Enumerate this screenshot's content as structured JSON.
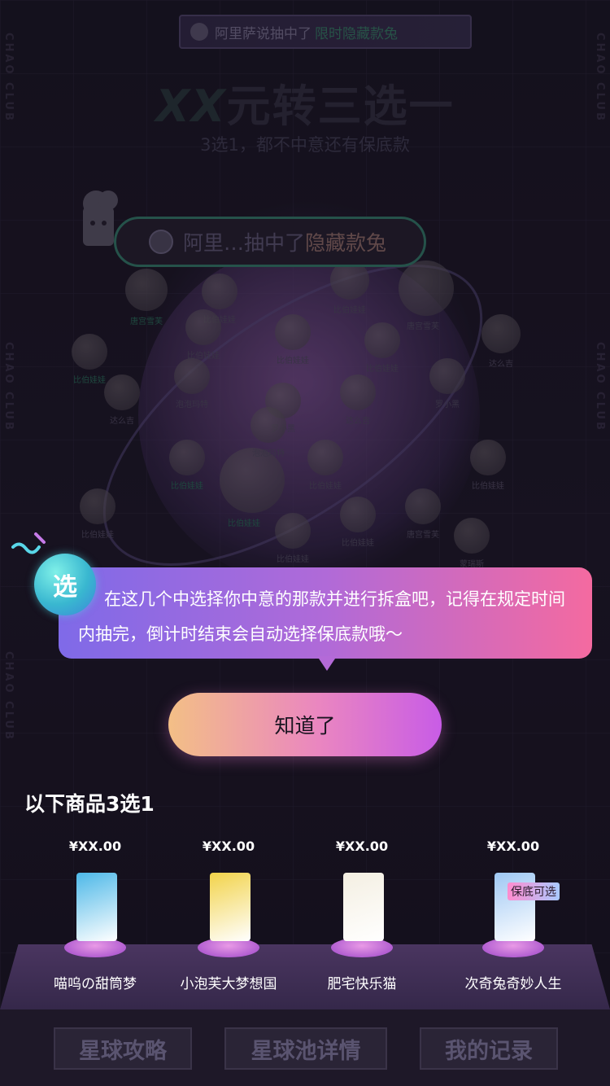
{
  "side_brand": "CHAO CLUB",
  "ticker": {
    "prefix": "阿里萨说抽中了",
    "highlight": "限时隐藏款兔"
  },
  "hero": {
    "title_xx": "XX",
    "title_rest": "元转三选一",
    "subtitle": "3选1，都不中意还有保底款"
  },
  "win_banner": {
    "prefix": "阿里…抽中了",
    "highlight": "隐藏款兔"
  },
  "prizes": [
    {
      "label": "唐宫雪芙",
      "green": true
    },
    {
      "label": "比伯娃娃",
      "green": false
    },
    {
      "label": "比伯娃娃",
      "green": false
    },
    {
      "label": "唐宫雪芙",
      "green": false
    },
    {
      "label": "达么吉",
      "green": false
    },
    {
      "label": "比伯娃娃",
      "green": false
    },
    {
      "label": "比伯娃娃",
      "green": false
    },
    {
      "label": "比伯娃娃",
      "green": false
    },
    {
      "label": "比伯娃娃",
      "green": true
    },
    {
      "label": "泡泡玛特",
      "green": false
    },
    {
      "label": "达么吉",
      "green": false
    },
    {
      "label": "罗小黑",
      "green": false
    },
    {
      "label": "比伯娃娃",
      "green": true
    },
    {
      "label": "比伯娃娃",
      "green": true
    },
    {
      "label": "达么吉",
      "green": false
    },
    {
      "label": "罗小黑",
      "green": false
    },
    {
      "label": "泡泡玛特",
      "green": false
    },
    {
      "label": "比伯娃娃",
      "green": false
    },
    {
      "label": "比伯娃娃",
      "green": false
    },
    {
      "label": "比伯娃娃",
      "green": false
    },
    {
      "label": "比伯娃娃",
      "green": false
    },
    {
      "label": "唐宫雪芙",
      "green": false
    },
    {
      "label": "蒙瑞斯",
      "green": false
    },
    {
      "label": "比伯娃娃",
      "green": false
    }
  ],
  "tip": {
    "badge": "选",
    "text": "在这几个中选择你中意的那款并进行拆盒吧，记得在规定时间内抽完，倒计时结束会自动选择保底款哦～"
  },
  "ok_button": "知道了",
  "pick_title": "以下商品3选1",
  "products": [
    {
      "price": "¥XX.00",
      "name": "喵呜の甜筒梦",
      "tag": "",
      "box_color": "#4db8e8"
    },
    {
      "price": "¥XX.00",
      "name": "小泡芙大梦想国",
      "tag": "",
      "box_color": "#f2d34a"
    },
    {
      "price": "¥XX.00",
      "name": "肥宅快乐猫",
      "tag": "",
      "box_color": "#f4efe2"
    },
    {
      "price": "¥XX.00",
      "name": "次奇兔奇妙人生",
      "tag": "保底可选",
      "box_color": "#9fc8f4"
    }
  ],
  "nav": {
    "guide": "星球攻略",
    "pool": "星球池详情",
    "records": "我的记录"
  }
}
